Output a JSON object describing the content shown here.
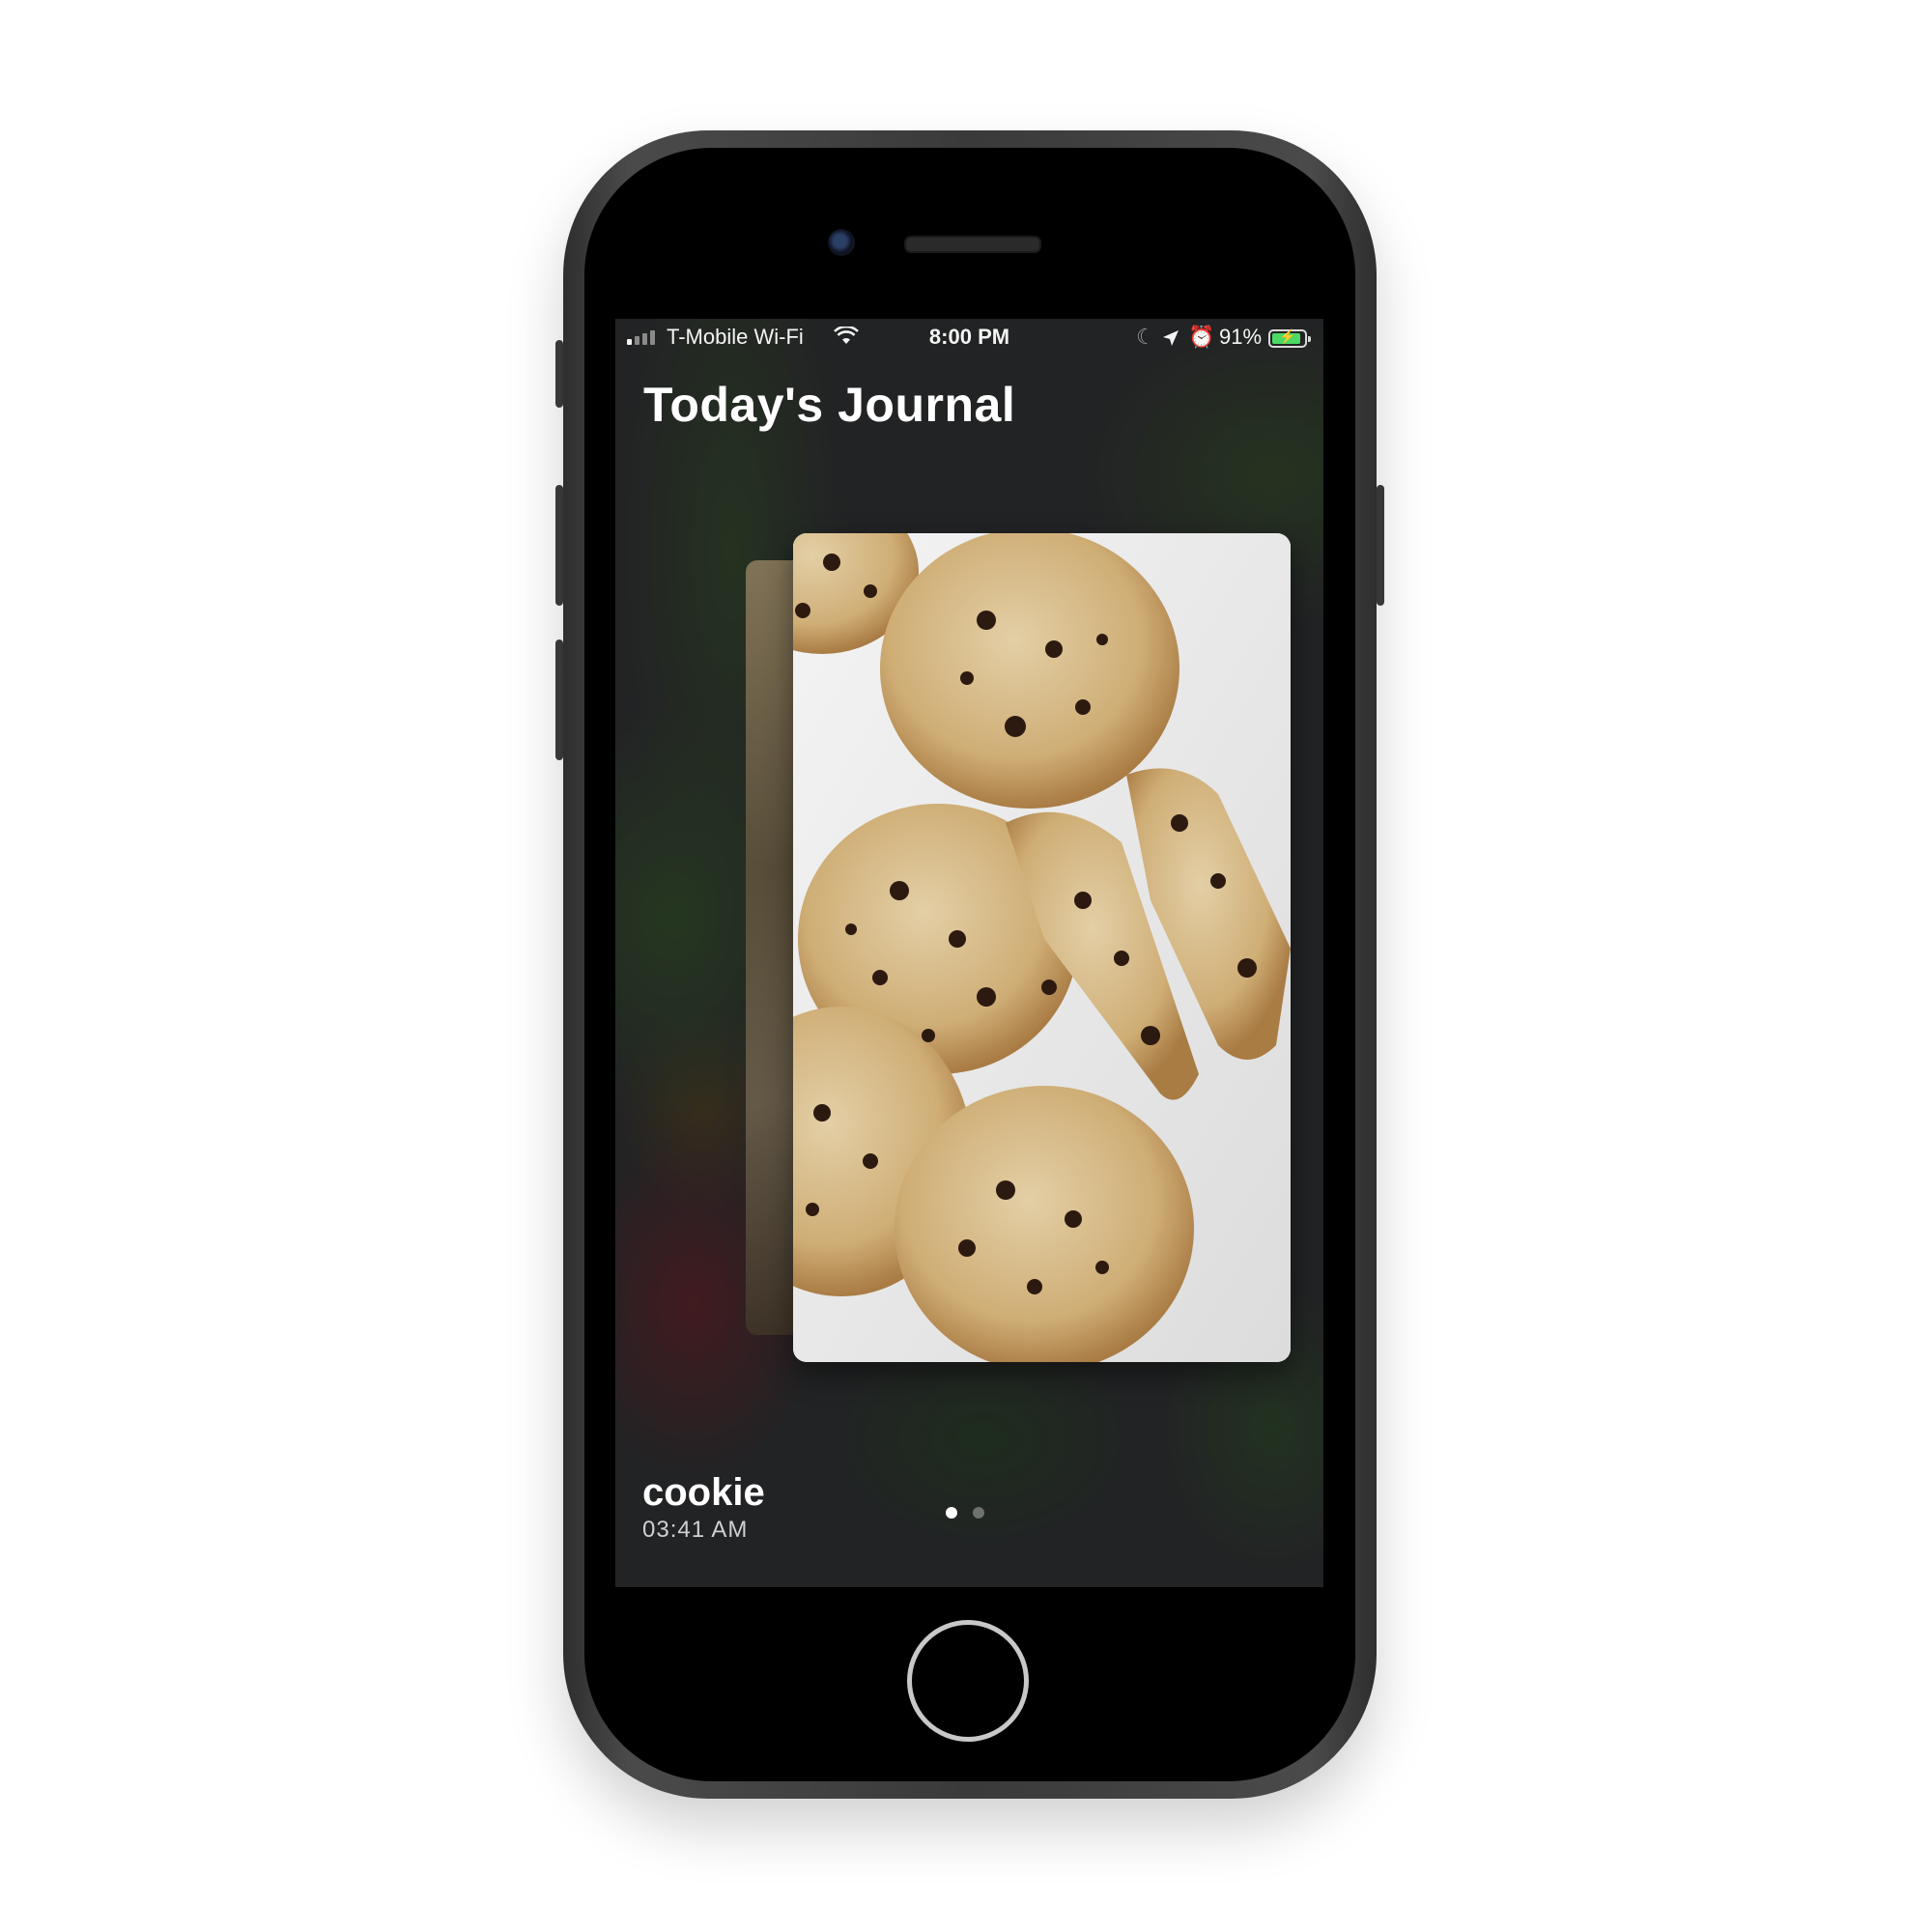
{
  "status_bar": {
    "carrier": "T-Mobile Wi-Fi",
    "time": "8:00 PM",
    "battery_percent": "91%",
    "battery_level": 0.91,
    "icons": [
      "signal-icon",
      "wifi-icon",
      "moon-icon",
      "location-icon",
      "alarm-icon",
      "battery-icon"
    ]
  },
  "journal": {
    "title": "Today's Journal",
    "current_entry": {
      "name": "cookie",
      "time": "03:41 AM"
    },
    "page_count": 2,
    "active_page": 0
  },
  "colors": {
    "battery_fill": "#4cd964",
    "text": "#ffffff"
  }
}
